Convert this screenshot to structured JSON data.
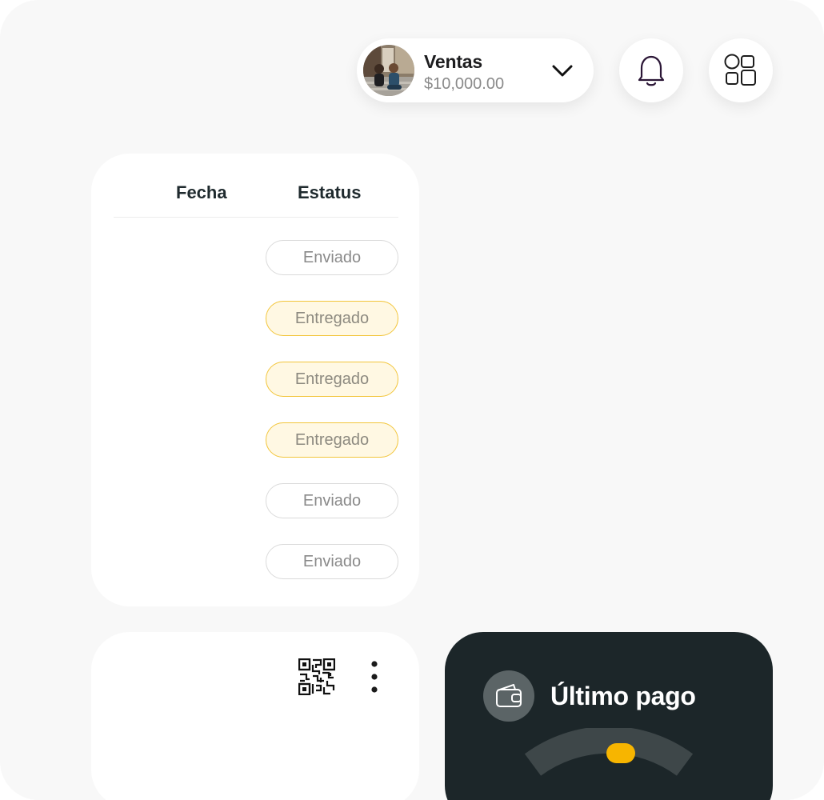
{
  "header": {
    "account_name": "Ventas",
    "account_amount": "$10,000.00"
  },
  "icons": {
    "dropdown": "chevron-down-icon",
    "notifications": "bell-icon",
    "apps": "apps-grid-icon",
    "qr": "qr-code-icon",
    "more": "more-vertical-icon",
    "wallet": "wallet-icon"
  },
  "orders": {
    "columns": [
      "Fecha",
      "Estatus"
    ],
    "rows": [
      {
        "fecha": "",
        "estatus": "Enviado",
        "state": "sent"
      },
      {
        "fecha": "",
        "estatus": "Entregado",
        "state": "delivered"
      },
      {
        "fecha": "",
        "estatus": "Entregado",
        "state": "delivered"
      },
      {
        "fecha": "",
        "estatus": "Entregado",
        "state": "delivered"
      },
      {
        "fecha": "",
        "estatus": "Enviado",
        "state": "sent"
      },
      {
        "fecha": "",
        "estatus": "Enviado",
        "state": "sent"
      }
    ]
  },
  "payment": {
    "title": "Último pago"
  },
  "colors": {
    "background": "#f8f8f8",
    "card": "#ffffff",
    "dark_card": "#1c2629",
    "accent": "#f7b500",
    "delivered_fill": "#fff8e3",
    "delivered_border": "#f2c53a",
    "bell_stroke": "#2b1636"
  }
}
